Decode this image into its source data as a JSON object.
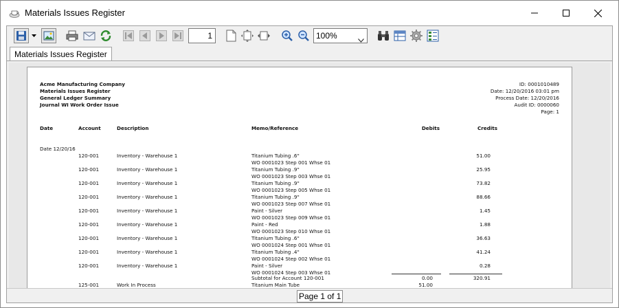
{
  "window": {
    "title": "Materials Issues Register"
  },
  "toolbar": {
    "page_number": "1",
    "zoom": "100%"
  },
  "tab": {
    "label": "Materials Issues Register"
  },
  "report": {
    "header_left": [
      "Acme Manufacturing Company",
      "Materials Issues Register",
      "General Ledger Summary",
      "Journal WI Work Order Issue"
    ],
    "header_right": [
      "ID: 0001010489",
      "Date: 12/20/2016 03:01 pm",
      "Process Date: 12/20/2016",
      "Audit ID: 0000060",
      "Page: 1"
    ],
    "columns": {
      "date": "Date",
      "account": "Account",
      "description": "Description",
      "memo": "Memo/Reference",
      "debits": "Debits",
      "credits": "Credits"
    },
    "date_group": "Date 12/20/16",
    "rows": [
      {
        "account": "120-001",
        "description": "Inventory - Warehouse 1",
        "memo": "Titanium Tubing .6\"",
        "ref": "WO 0001023 Step 001   Whse 01",
        "debit": "",
        "credit": "51.00"
      },
      {
        "account": "120-001",
        "description": "Inventory - Warehouse 1",
        "memo": "Titanium Tubing .9\"",
        "ref": "WO 0001023 Step 003   Whse 01",
        "debit": "",
        "credit": "25.95"
      },
      {
        "account": "120-001",
        "description": "Inventory - Warehouse 1",
        "memo": "Titanium Tubing .9\"",
        "ref": "WO 0001023 Step 005   Whse 01",
        "debit": "",
        "credit": "73.82"
      },
      {
        "account": "120-001",
        "description": "Inventory - Warehouse 1",
        "memo": "Titanium Tubing .9\"",
        "ref": "WO 0001023 Step 007   Whse 01",
        "debit": "",
        "credit": "88.66"
      },
      {
        "account": "120-001",
        "description": "Inventory - Warehouse 1",
        "memo": "Paint - Silver",
        "ref": "WO 0001023 Step 009   Whse 01",
        "debit": "",
        "credit": "1.45"
      },
      {
        "account": "120-001",
        "description": "Inventory - Warehouse 1",
        "memo": "Paint - Red",
        "ref": "WO 0001023 Step 010   Whse 01",
        "debit": "",
        "credit": "1.88"
      },
      {
        "account": "120-001",
        "description": "Inventory - Warehouse 1",
        "memo": "Titanium Tubing .6\"",
        "ref": "WO 0001024 Step 001   Whse 01",
        "debit": "",
        "credit": "36.63"
      },
      {
        "account": "120-001",
        "description": "Inventory - Warehouse 1",
        "memo": "Titanium Tubing .4\"",
        "ref": "WO 0001024 Step 002   Whse 01",
        "debit": "",
        "credit": "41.24"
      },
      {
        "account": "120-001",
        "description": "Inventory - Warehouse 1",
        "memo": "Paint - Silver",
        "ref": "WO 0001024 Step 003   Whse 01",
        "debit": "",
        "credit": "0.28"
      }
    ],
    "subtotal": {
      "label": "Subtotal for Account 120-001",
      "debit": "0.00",
      "credit": "320.91"
    },
    "last_row": {
      "account": "125-001",
      "description": "Work In Process",
      "memo": "Titanium Main Tube",
      "debit": "51.00",
      "credit": ""
    }
  },
  "status": {
    "page": "Page 1 of 1"
  },
  "icons": {
    "app": "teacup-icon",
    "save": "floppy-disk-icon",
    "export": "picture-icon",
    "print": "printer-icon",
    "email": "envelope-icon",
    "refresh": "refresh-icon",
    "first": "first-page-icon",
    "prev": "previous-page-icon",
    "next": "next-page-icon",
    "last": "last-page-icon",
    "find": "binoculars-icon"
  }
}
